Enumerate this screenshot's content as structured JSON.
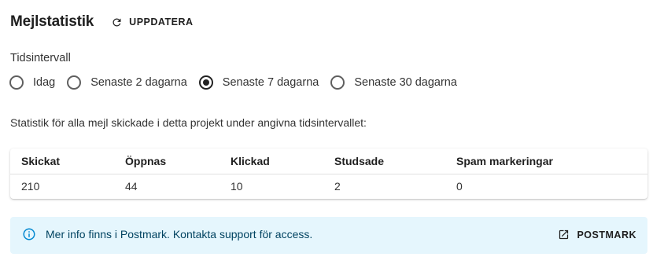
{
  "header": {
    "title": "Mejlstatistik",
    "refresh_label": "UPPDATERA",
    "refresh_icon": "refresh-icon"
  },
  "interval": {
    "label": "Tidsintervall",
    "options": [
      {
        "label": "Idag",
        "checked": false
      },
      {
        "label": "Senaste 2 dagarna",
        "checked": false
      },
      {
        "label": "Senaste 7 dagarna",
        "checked": true
      },
      {
        "label": "Senaste 30 dagarna",
        "checked": false
      }
    ]
  },
  "description": "Statistik för alla mejl skickade i detta projekt under angivna tidsintervallet:",
  "table": {
    "headers": [
      "Skickat",
      "Öppnas",
      "Klickad",
      "Studsade",
      "Spam markeringar"
    ],
    "row": [
      "210",
      "44",
      "10",
      "2",
      "0"
    ]
  },
  "info": {
    "text": "Mer info finns i Postmark. Kontakta support för access.",
    "button_label": "POSTMARK",
    "info_icon": "info-icon",
    "button_icon": "open-in-new-icon",
    "background": "#e5f6fd",
    "icon_color": "#0288d1",
    "text_color": "#014361"
  }
}
